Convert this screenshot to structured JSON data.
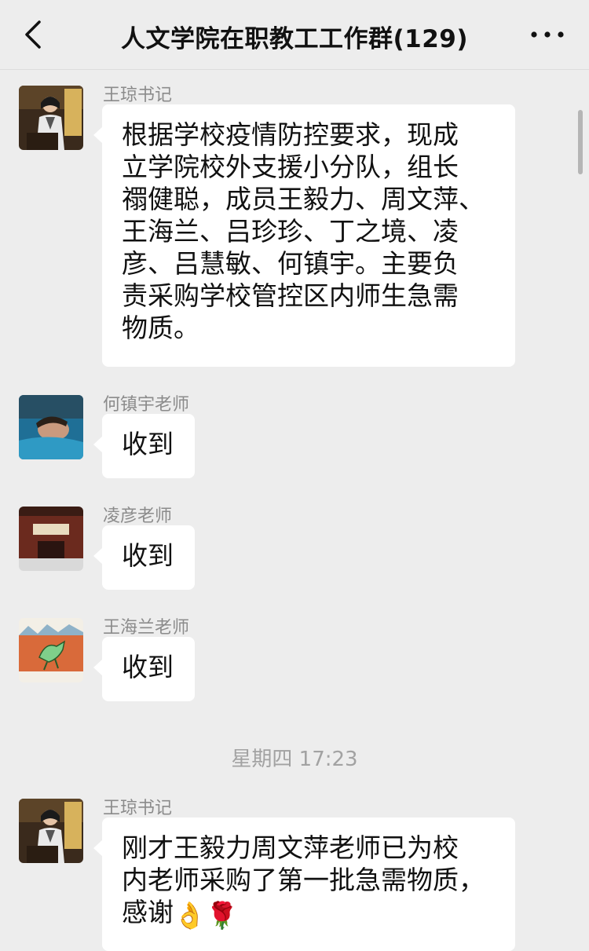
{
  "header": {
    "title": "人文学院在职教工工作群(129)",
    "back_icon": "chevron-left-icon",
    "more_icon": "more-dots-icon"
  },
  "messages": [
    {
      "sender": "王琼书记",
      "lines": [
        "根据学校疫情防控要求，现成",
        "立学院校外支援小分队，组长",
        "禤健聪，成员王毅力、周文萍、",
        "王海兰、吕珍珍、丁之境、凌",
        "彦、吕慧敏、何镇宇。主要负",
        "责采购学校管控区内师生急需",
        "物质。"
      ]
    },
    {
      "sender": "何镇宇老师",
      "text": "收到"
    },
    {
      "sender": "凌彦老师",
      "text": "收到"
    },
    {
      "sender": "王海兰老师",
      "text": "收到"
    }
  ],
  "timestamp": "星期四 17:23",
  "last_message": {
    "sender": "王琼书记",
    "lines": [
      "刚才王毅力周文萍老师已为校",
      "内老师采购了第一批急需物质，",
      "感谢"
    ],
    "emojis": [
      "👌",
      "🌹"
    ]
  },
  "colors": {
    "background": "#ededed",
    "bubble": "#ffffff",
    "sender_text": "#8b8b8b",
    "timestamp_text": "#a2a2a2"
  }
}
